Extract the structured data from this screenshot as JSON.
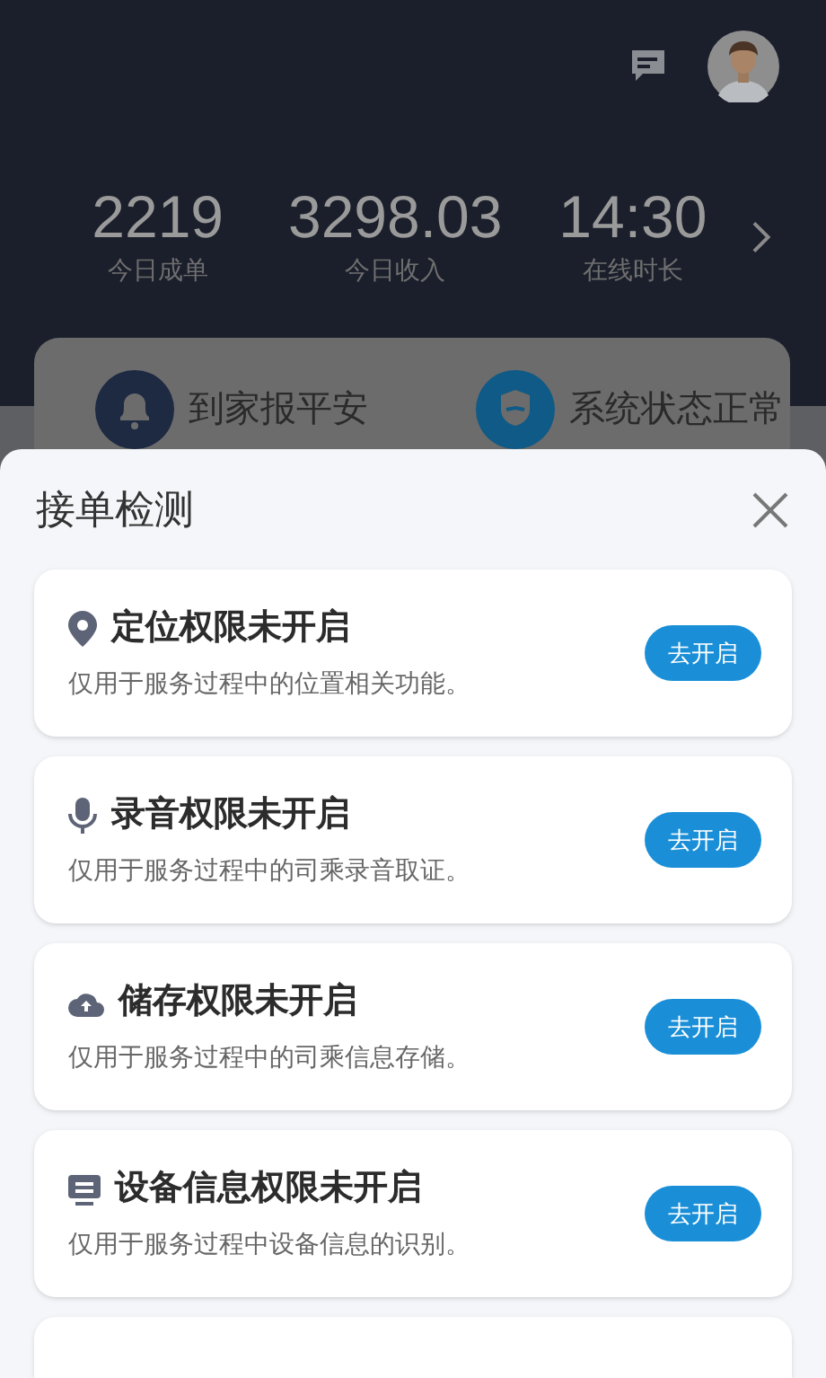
{
  "header": {
    "stats": [
      {
        "value": "2219",
        "label": "今日成单"
      },
      {
        "value": "3298.03",
        "label": "今日收入"
      },
      {
        "value": "14:30",
        "label": "在线时长"
      }
    ]
  },
  "quick_actions": [
    {
      "kind": "bell",
      "label": "到家报平安"
    },
    {
      "kind": "shield",
      "label": "系统状态正常"
    }
  ],
  "sheet": {
    "title": "接单检测",
    "permissions": [
      {
        "kind": "location",
        "title": "定位权限未开启",
        "description": "仅用于服务过程中的位置相关功能。",
        "button": "去开启"
      },
      {
        "kind": "microphone",
        "title": "录音权限未开启",
        "description": "仅用于服务过程中的司乘录音取证。",
        "button": "去开启"
      },
      {
        "kind": "storage",
        "title": "储存权限未开启",
        "description": "仅用于服务过程中的司乘信息存储。",
        "button": "去开启"
      },
      {
        "kind": "device",
        "title": "设备信息权限未开启",
        "description": "仅用于服务过程中设备信息的识别。",
        "button": "去开启"
      }
    ]
  }
}
